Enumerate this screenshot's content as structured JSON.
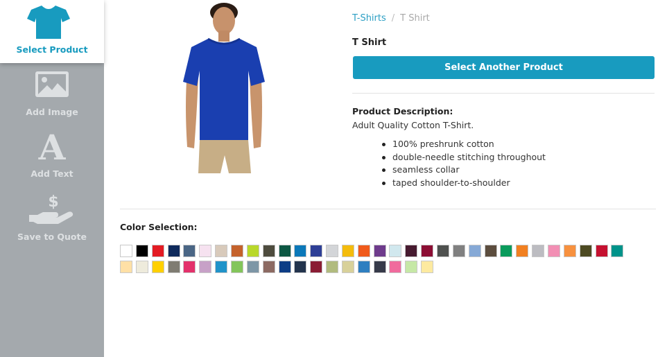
{
  "sidebar": {
    "items": [
      {
        "label": "Select Product",
        "icon": "tshirt-icon",
        "active": true
      },
      {
        "label": "Add Image",
        "icon": "image-icon",
        "active": false
      },
      {
        "label": "Add Text",
        "icon": "letter-a-icon",
        "active": false
      },
      {
        "label": "Save to Quote",
        "icon": "hand-dollar-icon",
        "active": false
      }
    ]
  },
  "product": {
    "image_icon": "blue-tshirt-model-photo",
    "shirt_color": "#1a3fb0"
  },
  "breadcrumb": {
    "parent": "T-Shirts",
    "separator": "/",
    "current": "T Shirt"
  },
  "details": {
    "title": "T Shirt",
    "button_label": "Select Another Product",
    "description_heading": "Product Description:",
    "description_text": "Adult Quality Cotton T-Shirt.",
    "features": [
      "100% preshrunk cotton",
      "double-needle stitching throughout",
      "seamless collar",
      "taped shoulder-to-shoulder"
    ]
  },
  "colors": {
    "heading": "Color Selection:",
    "swatches": [
      "#ffffff",
      "#000000",
      "#e31b23",
      "#0f2a5c",
      "#4a6685",
      "#f6e2f0",
      "#d8cabb",
      "#c4622c",
      "#b9d82b",
      "#4e4c3e",
      "#0d5743",
      "#0b78b9",
      "#2e3f96",
      "#d3d5d8",
      "#f4bc0c",
      "#f05a1b",
      "#6e3b8c",
      "#d1e8ee",
      "#471b30",
      "#8c0e34",
      "#4f514f",
      "#808080",
      "#86a9d6",
      "#5c4d3e",
      "#0a9b5c",
      "#f18021",
      "#bcbcc1",
      "#f28fb4",
      "#f7913f",
      "#4d4a22",
      "#c51130",
      "#00938a",
      "#ffe0a6",
      "#eeebdc",
      "#ffd000",
      "#7f7c72",
      "#e3316b",
      "#c7a1c7",
      "#2093c9",
      "#83c55b",
      "#7d96a6",
      "#8c6a62",
      "#0d3d85",
      "#23344d",
      "#8a1d34",
      "#b1bb7e",
      "#d8d19a",
      "#2f7fc0",
      "#363a49",
      "#f06b9d",
      "#c6e8a6",
      "#fdeaa0"
    ]
  }
}
